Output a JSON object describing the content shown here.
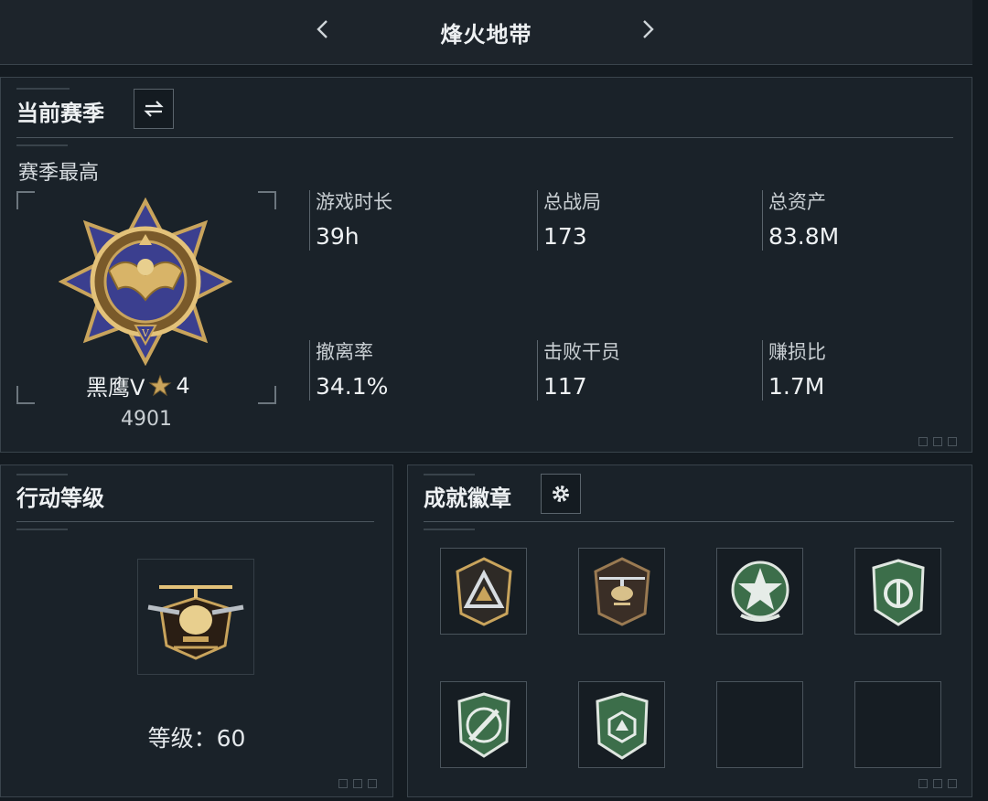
{
  "header": {
    "title": "烽火地带"
  },
  "season": {
    "title": "当前赛季",
    "subtitle": "赛季最高",
    "rank": {
      "name": "黑鹰V",
      "stars": "4",
      "score": "4901",
      "medal_icon": "black-eagle-v-medal-icon"
    },
    "stats": [
      {
        "label": "游戏时长",
        "value": "39h"
      },
      {
        "label": "总战局",
        "value": "173"
      },
      {
        "label": "总资产",
        "value": "83.8M"
      },
      {
        "label": "撤离率",
        "value": "34.1%"
      },
      {
        "label": "击败干员",
        "value": "117"
      },
      {
        "label": "赚损比",
        "value": "1.7M"
      }
    ]
  },
  "level": {
    "title": "行动等级",
    "label": "等级：60",
    "emblem_icon": "helicopter-emblem-icon"
  },
  "badges": {
    "title": "成就徽章",
    "slots": [
      {
        "icon": "triangle-shield-badge-icon",
        "filled": true
      },
      {
        "icon": "helicopter-badge-icon",
        "filled": true
      },
      {
        "icon": "star-medal-badge-icon",
        "filled": true
      },
      {
        "icon": "green-shield-badge-icon",
        "filled": true
      },
      {
        "icon": "missile-badge-icon",
        "filled": true
      },
      {
        "icon": "hexagon-shield-badge-icon",
        "filled": true
      },
      {
        "icon": "",
        "filled": false
      },
      {
        "icon": "",
        "filled": false
      }
    ]
  },
  "colors": {
    "background": "#141b21",
    "panel": "#1a2229",
    "border": "#3a444c",
    "gold": "#c9a45c",
    "medal_blue": "#3b3f8f",
    "badge_green": "#3c6e4a"
  }
}
